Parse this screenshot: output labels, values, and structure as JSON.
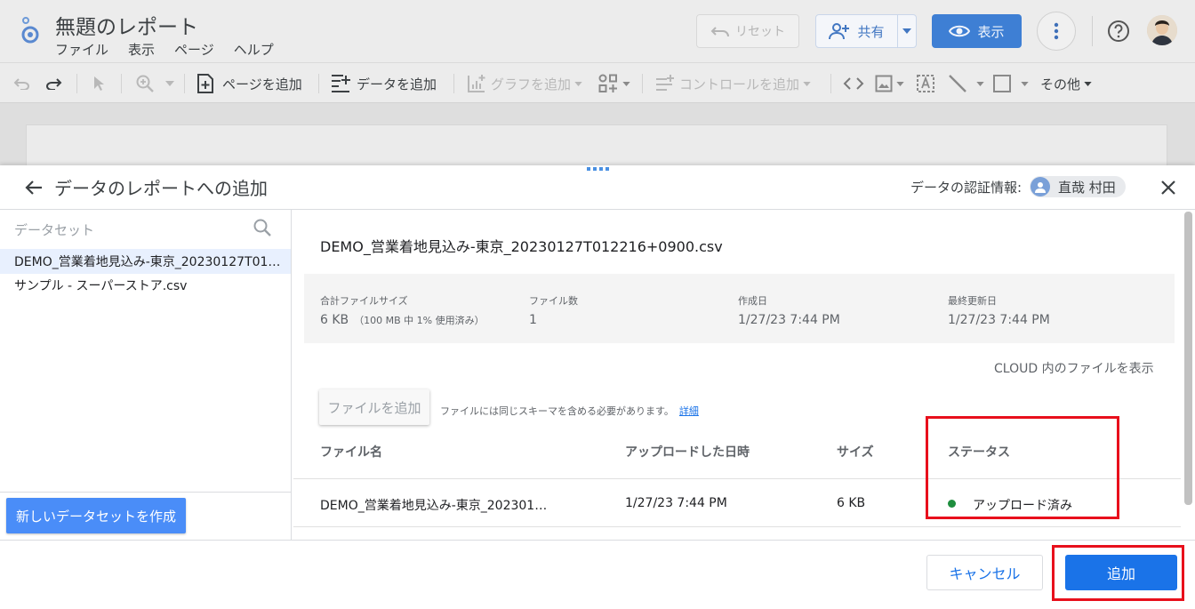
{
  "app": {
    "title": "無題のレポート",
    "menu": [
      "ファイル",
      "表示",
      "ページ",
      "ヘルプ"
    ],
    "reset_label": "リセット",
    "share_label": "共有",
    "view_label": "表示"
  },
  "toolbar": {
    "add_page": "ページを追加",
    "add_data": "データを追加",
    "add_chart": "グラフを追加",
    "add_control": "コントロールを追加",
    "more": "その他"
  },
  "panel": {
    "title": "データのレポートへの追加",
    "credentials_label": "データの認証情報:",
    "credentials_user": "直哉 村田"
  },
  "sidebar": {
    "search_placeholder": "データセット",
    "datasets": [
      {
        "label": "DEMO_営業着地見込み-東京_20230127T01…",
        "selected": true
      },
      {
        "label": "サンプル - スーパーストア.csv",
        "selected": false
      }
    ],
    "new_dataset_label": "新しいデータセットを作成"
  },
  "detail": {
    "file_title": "DEMO_営業着地見込み-東京_20230127T012216+0900.csv",
    "stats": [
      {
        "label": "合計ファイルサイズ",
        "value": "6 KB",
        "note": "（100 MB 中 1% 使用済み）"
      },
      {
        "label": "ファイル数",
        "value": "1",
        "note": ""
      },
      {
        "label": "作成日",
        "value": "1/27/23 7:44 PM",
        "note": ""
      },
      {
        "label": "最終更新日",
        "value": "1/27/23 7:44 PM",
        "note": ""
      }
    ],
    "cloud_link": "CLOUD 内のファイルを表示",
    "add_file_label": "ファイルを追加",
    "schema_note": "ファイルには同じスキーマを含める必要があります。",
    "schema_link": "詳細",
    "table": {
      "headers": [
        "ファイル名",
        "アップロードした日時",
        "サイズ",
        "ステータス"
      ],
      "rows": [
        {
          "name": "DEMO_営業着地見込み-東京_202301…",
          "uploaded": "1/27/23 7:44 PM",
          "size": "6 KB",
          "status": "アップロード済み"
        }
      ]
    }
  },
  "footer": {
    "cancel_label": "キャンセル",
    "add_label": "追加"
  },
  "colors": {
    "primary": "#1a73e8",
    "highlight": "#e8101c",
    "status_ok": "#1e8e3e"
  }
}
